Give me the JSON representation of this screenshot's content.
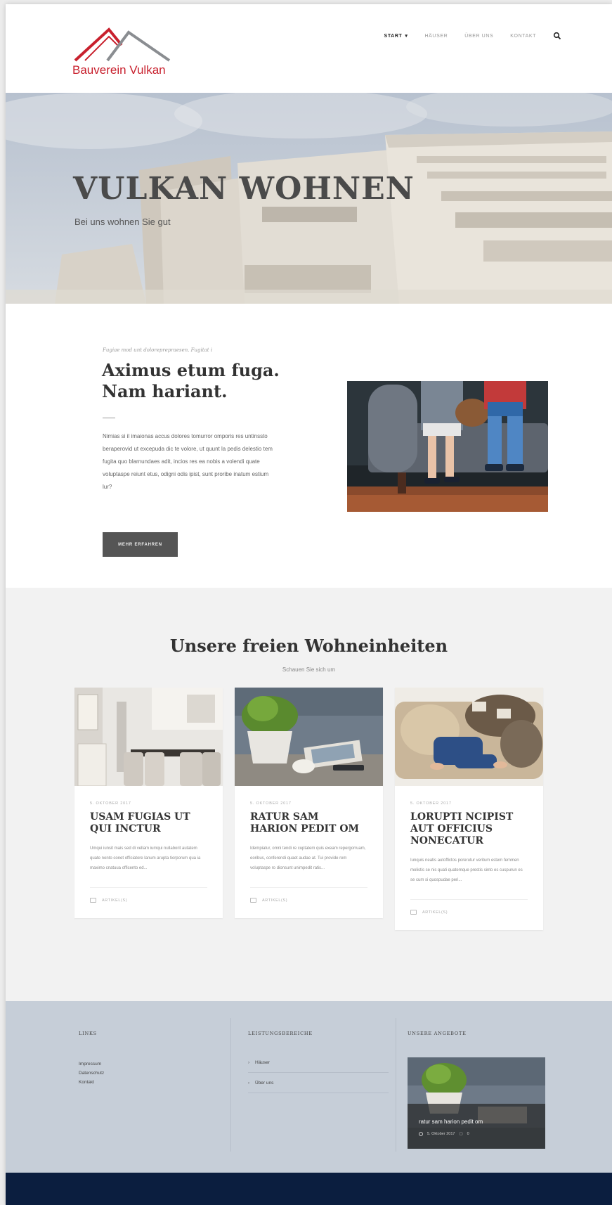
{
  "brand": {
    "name": "Bauverein Vulkan",
    "color_red": "#c8202d",
    "color_grey": "#8a8d91"
  },
  "nav": {
    "items": [
      {
        "label": "Start",
        "active": true,
        "has_caret": true
      },
      {
        "label": "Häuser",
        "active": false
      },
      {
        "label": "Über uns",
        "active": false
      },
      {
        "label": "Kontakt",
        "active": false
      }
    ],
    "caret": "▾",
    "search_icon": "search-icon"
  },
  "hero": {
    "title": "VULKAN WOHNEN",
    "subtitle": "Bei uns wohnen Sie gut"
  },
  "intro": {
    "kicker": "Fugiae mod unt doloreprepraesen. Fugitat i",
    "heading": "Aximus etum fuga. Nam hariant.",
    "text": "Nimias si il imaionas accus dolores tomurror omporis res untinssto beraperovid ut excepuda dic te volore, ut quunt la pedis delestio tem fugita quo blarnundaes adit, incios res ea nobis a volendi quate voluptaspe reiunt etus, odigni odis ipist, sunt proribe inatum estium lur?",
    "button_label": "Mehr erfahren"
  },
  "listings": {
    "title": "Unsere freien Wohneinheiten",
    "subtitle": "Schauen Sie sich um",
    "cards": [
      {
        "date": "5. Oktober 2017",
        "title": "USAM FUGIAS UT QUI INCTUR",
        "excerpt": "Umqui iunsit mais sed di vellam iumqui nullaborit autatem quate nonto conet officiatore lanum arupta tiorporum qua ia maximo cnatuua officento ed...",
        "category": "Artikel(s)"
      },
      {
        "date": "5. Oktober 2017",
        "title": "RATUR SAM HARION PEDIT OM",
        "excerpt": "Idempiatur, omni tendi re cuptatem quis exeam repergorruam, eoribus, conferendi quaet audae at. Tui provide rem voluptaspe ro dionsunt unimpedit ratis...",
        "category": "Artikel(s)"
      },
      {
        "date": "5. Oktober 2017",
        "title": "LORUPTI NCIPIST AUT OFFICIUS NONECATUR",
        "excerpt": "Iunquis neatis autoffictos porerutur veritum estem femmen molistis se nis quati quatemque prestis sinto es cuspurun es se cum si quospudae peri...",
        "category": "Artikel(s)"
      }
    ]
  },
  "footer": {
    "links_title": "Links",
    "links": [
      "Impressum",
      "Datenschutz",
      "Kontakt"
    ],
    "services_title": "Leistungsbereiche",
    "services": [
      "Häuser",
      "Über uns"
    ],
    "offers_title": "Unsere Angebote",
    "offer": {
      "title": "ratur sam harion pedit om",
      "date": "5. Oktober 2017",
      "comments": "0"
    },
    "bottom_color": "#0b1e3f"
  }
}
